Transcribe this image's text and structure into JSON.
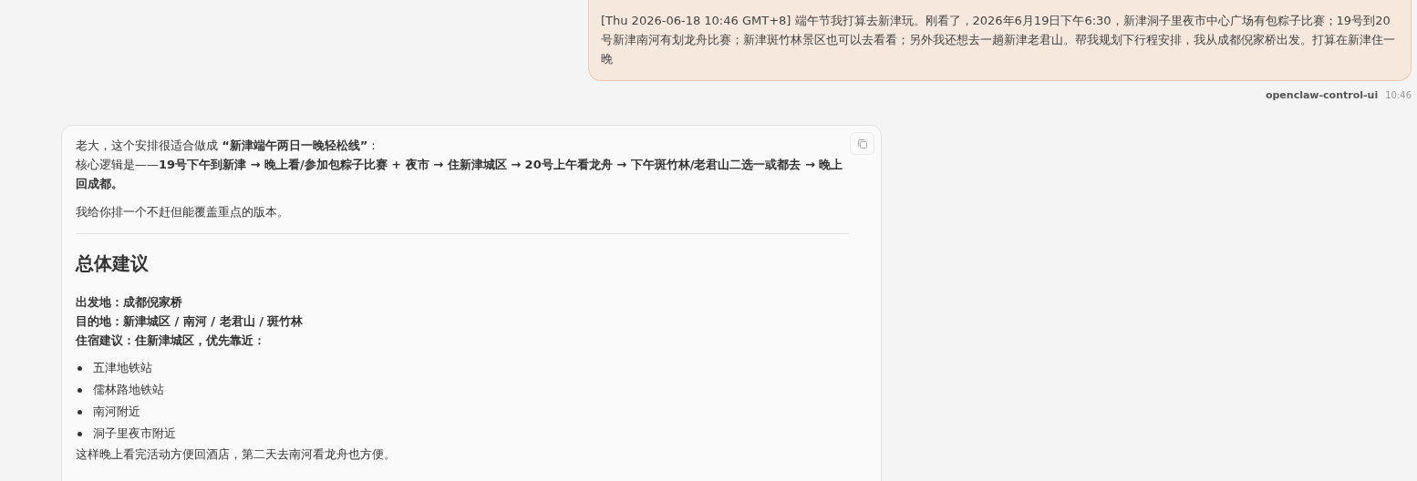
{
  "user_message": {
    "text": "[Thu 2026-06-18 10:46 GMT+8] 端午节我打算去新津玩。刚看了，2026年6月19日下午6:30，新津洞子里夜市中心广场有包粽子比赛；19号到20号新津南河有划龙舟比赛；新津斑竹林景区也可以去看看；另外我还想去一趟新津老君山。帮我规划下行程安排，我从成都倪家桥出发。打算在新津住一晚",
    "sender": "openclaw-control-ui",
    "time": "10:46"
  },
  "assistant_message": {
    "intro_lines": [
      "老大，这个安排很适合做成 **“新津端午两日一晚轻松线”**：",
      "核心逻辑是——**19号下午到新津 → 晚上看/参加包粽子比赛 + 夜市 → 住新津城区 → 20号上午看龙舟 → 下午斑竹林/老君山二选一或都去 → 晚上回成都。**"
    ],
    "note": "我给你排一个不赶但能覆盖重点的版本。",
    "heading": "总体建议",
    "facts": [
      "出发地：成都倪家桥",
      "目的地：新津城区 / 南河 / 老君山 / 斑竹林",
      "住宿建议：住新津城区，优先靠近："
    ],
    "bullets": [
      "五津地铁站",
      "儒林路地铁站",
      "南河附近",
      "洞子里夜市附近"
    ],
    "after": "这样晚上看完活动方便回酒店，第二天去南河看龙舟也方便。"
  }
}
